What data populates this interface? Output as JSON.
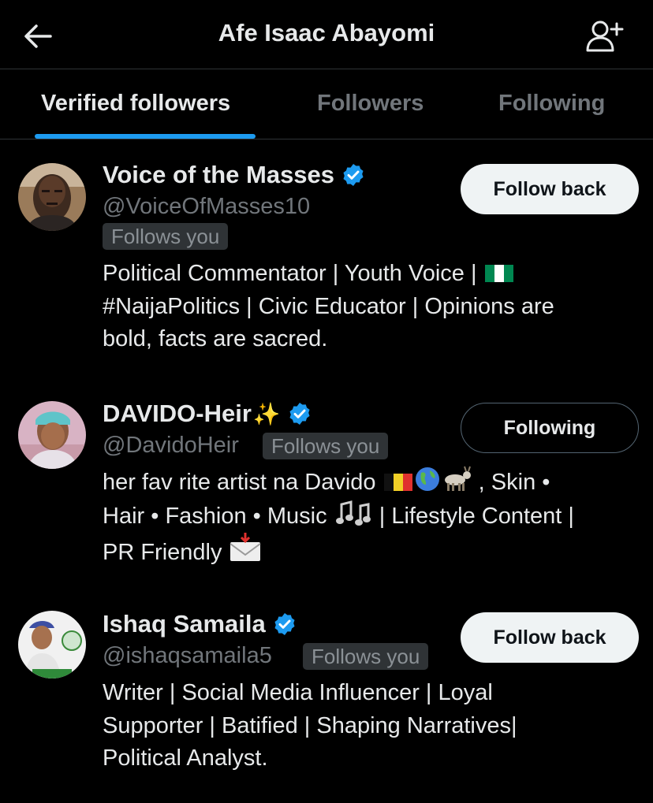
{
  "header": {
    "title": "Afe Isaac Abayomi",
    "back_icon": "arrow-left-icon",
    "add_icon": "add-user-icon"
  },
  "tabs": [
    {
      "label": "Verified followers",
      "active": true
    },
    {
      "label": "Followers",
      "active": false
    },
    {
      "label": "Following",
      "active": false
    }
  ],
  "accent_color": "#1d9bf0",
  "users": [
    {
      "name": "Voice of the Masses",
      "handle": "@VoiceOfMasses10",
      "badge": "Follows you",
      "verified": true,
      "button": "Follow back",
      "bio_parts": [
        "Political Commentator | Youth Voice | ",
        "#NaijaPolitics | Civic Educator | Opinions are",
        "bold, facts are sacred."
      ]
    },
    {
      "name": "DAVIDO-Heir",
      "handle": "@DavidoHeir",
      "badge": "Follows you",
      "verified": true,
      "button": "Following",
      "bio_parts": [
        "her fav rite artist na Davido ",
        " , Skin •",
        "Hair • Fashion • Music ",
        " | Lifestyle Content |",
        "PR Friendly "
      ]
    },
    {
      "name": "Ishaq Samaila",
      "handle": "@ishaqsamaila5",
      "badge": "Follows you",
      "verified": true,
      "button": "Follow back",
      "bio_parts": [
        "Writer | Social Media Influencer | Loyal",
        "Supporter | Batified | Shaping Narratives|",
        "Political Analyst."
      ]
    }
  ]
}
